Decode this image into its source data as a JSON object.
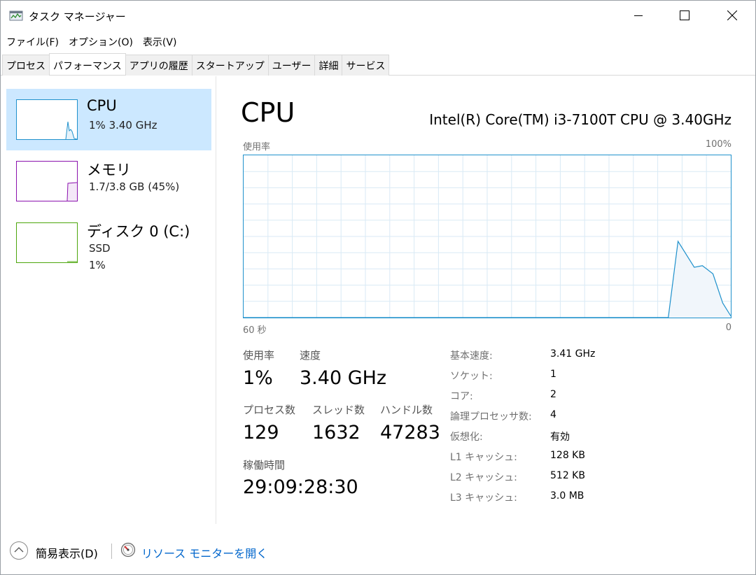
{
  "window": {
    "title": "タスク マネージャー",
    "icon": "task-manager-icon"
  },
  "menu": {
    "file": "ファイル(F)",
    "options": "オプション(O)",
    "view": "表示(V)"
  },
  "tabs": [
    {
      "label": "プロセス"
    },
    {
      "label": "パフォーマンス"
    },
    {
      "label": "アプリの履歴"
    },
    {
      "label": "スタートアップ"
    },
    {
      "label": "ユーザー"
    },
    {
      "label": "詳細"
    },
    {
      "label": "サービス"
    }
  ],
  "sidebar": {
    "items": [
      {
        "title": "CPU",
        "line1": "1%  3.40 GHz",
        "line2": "",
        "color": "#1f91cc"
      },
      {
        "title": "メモリ",
        "line1": "1.7/3.8 GB (45%)",
        "line2": "",
        "color": "#8b12ae"
      },
      {
        "title": "ディスク 0 (C:)",
        "line1": "SSD",
        "line2": "1%",
        "color": "#4da60c"
      }
    ]
  },
  "main": {
    "heading": "CPU",
    "model": "Intel(R) Core(TM) i3-7100T CPU @ 3.40GHz",
    "graph": {
      "top_left": "使用率",
      "top_right": "100%",
      "bottom_left": "60 秒",
      "bottom_right": "0",
      "color": "#1f91cc"
    },
    "stats": {
      "usage_label": "使用率",
      "usage_value": "1%",
      "speed_label": "速度",
      "speed_value": "3.40 GHz",
      "processes_label": "プロセス数",
      "processes_value": "129",
      "threads_label": "スレッド数",
      "threads_value": "1632",
      "handles_label": "ハンドル数",
      "handles_value": "47283",
      "uptime_label": "稼働時間",
      "uptime_value": "29:09:28:30"
    },
    "info": [
      {
        "label": "基本速度:",
        "value": "3.41 GHz"
      },
      {
        "label": "ソケット:",
        "value": "1"
      },
      {
        "label": "コア:",
        "value": "2"
      },
      {
        "label": "論理プロセッサ数:",
        "value": "4"
      },
      {
        "label": "仮想化:",
        "value": "有効"
      },
      {
        "label": "L1 キャッシュ:",
        "value": "128 KB"
      },
      {
        "label": "L2 キャッシュ:",
        "value": "512 KB"
      },
      {
        "label": "L3 キャッシュ:",
        "value": "3.0 MB"
      }
    ]
  },
  "footer": {
    "fewer_details": "簡易表示(D)",
    "resource_monitor": "リソース モニターを開く"
  },
  "chart_data": {
    "type": "area",
    "ylim": [
      0,
      100
    ],
    "xlim": [
      60,
      0
    ],
    "x": [
      60,
      7.7,
      6.5,
      4.5,
      3.5,
      2.2,
      1.0,
      0
    ],
    "y": [
      0,
      0,
      47,
      31,
      32,
      27,
      9,
      1
    ]
  }
}
